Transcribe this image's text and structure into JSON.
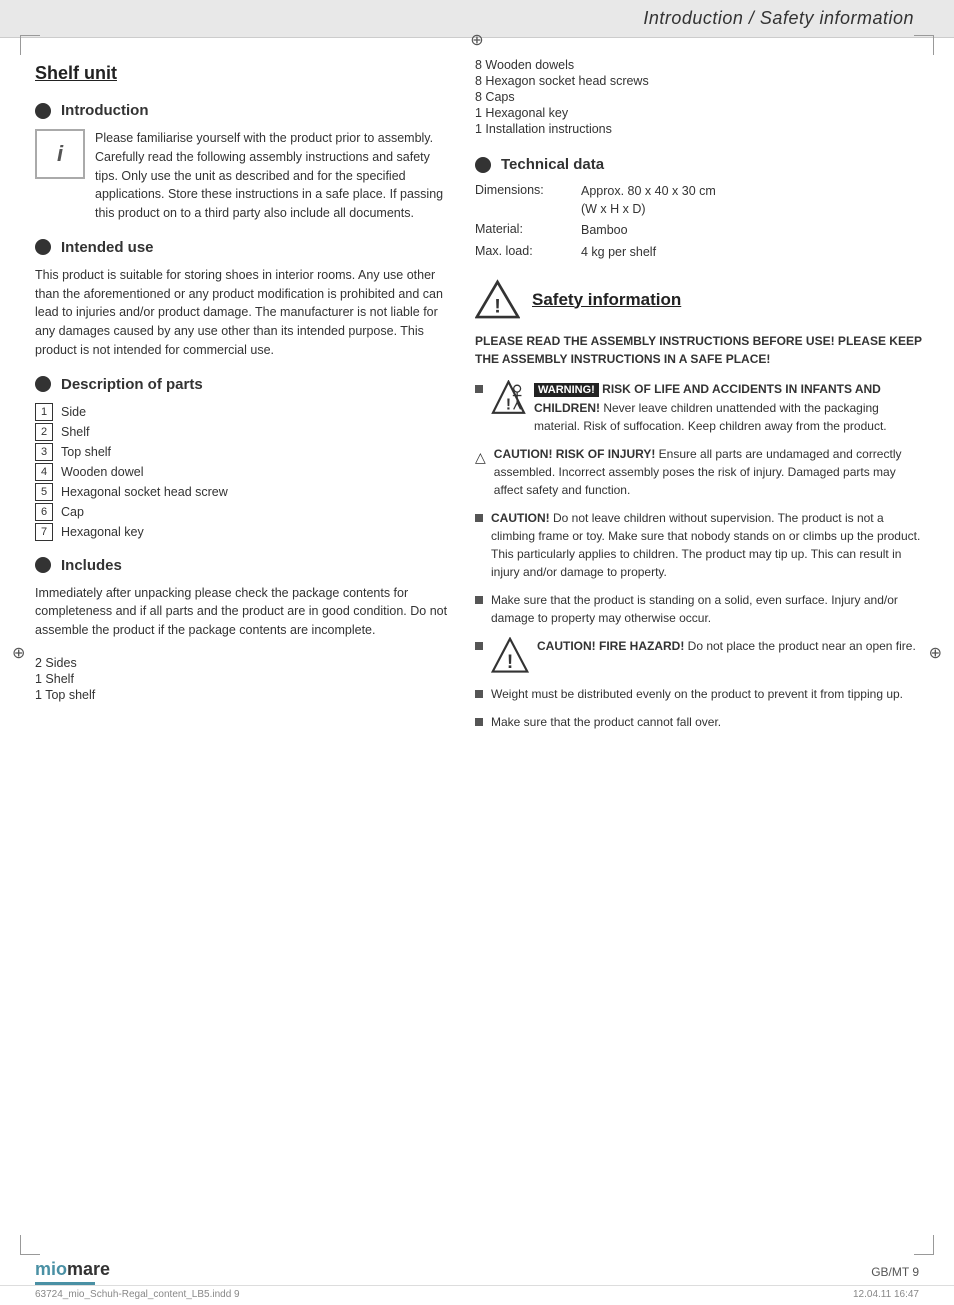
{
  "header": {
    "title": "Introduction / Safety information"
  },
  "left": {
    "shelf_unit_title": "Shelf unit",
    "introduction": {
      "section_title": "Introduction",
      "intro_text_part1": "Please familiarise yourself with the product prior to assembly. Carefully read the following assembly instructions and safety tips. Only use the unit as described and for the specified applications. Store these instructions in a safe place. If passing this product on to a third party also include all documents."
    },
    "intended_use": {
      "section_title": "Intended use",
      "body": "This product is suitable for storing shoes in interior rooms. Any use other than the aforementioned or any product modification is prohibited and can lead to injuries and/or product damage. The manufacturer is not liable for any damages caused by any use other than its intended purpose. This product is not intended for commercial use."
    },
    "description_of_parts": {
      "section_title": "Description of parts",
      "parts": [
        {
          "num": "1",
          "name": "Side"
        },
        {
          "num": "2",
          "name": "Shelf"
        },
        {
          "num": "3",
          "name": "Top shelf"
        },
        {
          "num": "4",
          "name": "Wooden dowel"
        },
        {
          "num": "5",
          "name": "Hexagonal socket head screw"
        },
        {
          "num": "6",
          "name": "Cap"
        },
        {
          "num": "7",
          "name": "Hexagonal key"
        }
      ]
    },
    "includes": {
      "section_title": "Includes",
      "body": "Immediately after unpacking please check the package contents for completeness and if all parts and the product are in good condition. Do not assemble the product if the package contents are incomplete.",
      "items": [
        "2 Sides",
        "1 Shelf",
        "1 Top shelf"
      ]
    }
  },
  "right": {
    "includes_continued": [
      "8 Wooden dowels",
      "8 Hexagon socket head screws",
      "8 Caps",
      "1 Hexagonal key",
      "1 Installation instructions"
    ],
    "technical_data": {
      "section_title": "Technical data",
      "rows": [
        {
          "label": "Dimensions:",
          "value": "Approx. 80 x 40 x 30 cm\n(W x H x D)"
        },
        {
          "label": "Material:",
          "value": "Bamboo"
        },
        {
          "label": "Max. load:",
          "value": "4 kg per shelf"
        }
      ]
    },
    "safety": {
      "section_title": "Safety information",
      "intro": "PLEASE READ THE ASSEMBLY INSTRUCTIONS BEFORE USE! PLEASE KEEP THE ASSEMBLY INSTRUCTIONS IN A SAFE PLACE!",
      "items": [
        {
          "type": "warning-child",
          "text_bold": "WARNING! RISK OF LIFE AND ACCIDENTS IN INFANTS AND CHILDREN!",
          "text_normal": " Never leave children unattended with the packaging material. Risk of suffocation. Keep children away from the product."
        },
        {
          "type": "caution-triangle",
          "text_bold": "CAUTION! RISK OF INJURY!",
          "text_normal": " Ensure all parts are undamaged and correctly assembled. Incorrect assembly poses the risk of injury. Damaged parts may affect safety and function."
        },
        {
          "type": "bullet",
          "text_bold": "CAUTION!",
          "text_normal": " Do not leave children without supervision. The product is not a climbing frame or toy. Make sure that nobody stands on or climbs up the product. This particularly applies to children. The product may tip up. This can result in injury and/or damage to property."
        },
        {
          "type": "bullet",
          "text_normal": "Make sure that the product is standing on a solid, even surface. Injury and/or damage to property may otherwise occur."
        },
        {
          "type": "fire",
          "text_bold": "CAUTION! FIRE HAZARD!",
          "text_normal": " Do not place the product near an open fire."
        },
        {
          "type": "bullet",
          "text_normal": "Weight must be distributed evenly on the product to prevent it from tipping up."
        },
        {
          "type": "bullet",
          "text_normal": "Make sure that the product cannot fall over."
        }
      ]
    }
  },
  "logo": {
    "text": "miomare"
  },
  "page_number": "GB/MT    9",
  "print_info_left": "63724_mio_Schuh-Regal_content_LB5.indd   9",
  "print_info_right": "12.04.11   16:47"
}
